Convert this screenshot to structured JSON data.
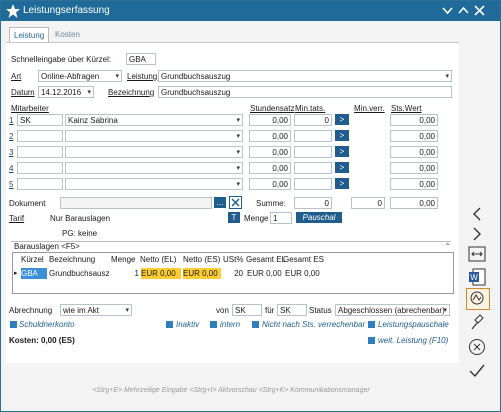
{
  "window": {
    "title": "Leistungserfassung"
  },
  "tabs": [
    {
      "label": "Leistung"
    },
    {
      "label": "Kosten"
    }
  ],
  "quick": {
    "label": "Schnelleingabe über Kürzel:",
    "value": "GBA"
  },
  "art": {
    "label": "Art",
    "value": "Online-Abfragen"
  },
  "leistung": {
    "label": "Leistung",
    "value": "Grundbuchsauszug"
  },
  "datum": {
    "label": "Datum",
    "value": "14.12.2016"
  },
  "bezeichnung": {
    "label": "Bezeichnung",
    "value": "Grundbuchsauszug"
  },
  "headers": {
    "mitarbeiter": "Mitarbeiter",
    "stundensatz": "Stundensatz",
    "min_tats": "Min.tats.",
    "min_verr": "Min.verr.",
    "sts_wert": "Sts.Wert"
  },
  "rows": [
    {
      "num": "1",
      "kuerzel": "SK",
      "name": "Kainz Sabrina",
      "stundensatz": "0,00",
      "min_tats": "0",
      "btn": ">",
      "sts_wert": "0,00"
    },
    {
      "num": "2",
      "kuerzel": "",
      "name": "",
      "stundensatz": "0,00",
      "min_tats": "",
      "btn": ">",
      "sts_wert": "0,00"
    },
    {
      "num": "3",
      "kuerzel": "",
      "name": "",
      "stundensatz": "0,00",
      "min_tats": "",
      "btn": ">",
      "sts_wert": "0,00"
    },
    {
      "num": "4",
      "kuerzel": "",
      "name": "",
      "stundensatz": "0,00",
      "min_tats": "",
      "btn": ">",
      "sts_wert": "0,00"
    },
    {
      "num": "5",
      "kuerzel": "",
      "name": "",
      "stundensatz": "0,00",
      "min_tats": "",
      "btn": ">",
      "sts_wert": "0,00"
    }
  ],
  "dokument": {
    "label": "Dokument",
    "btn": "...",
    "summe_label": "Summe:",
    "summe_tats": "0",
    "summe_verr": "0",
    "summe_wert": "0,00"
  },
  "tarif": {
    "label": "Tarif",
    "value": "Nur Barauslagen",
    "t_btn": "T",
    "menge_label": "Menge",
    "menge_value": "1",
    "pauschal": "Pauschal"
  },
  "pg": "PG: keine",
  "barauslagen": {
    "title": "Barauslagen <F5>",
    "columns": [
      "Kürzel",
      "Bezeichnung",
      "Menge",
      "Netto (EL)",
      "Netto (ES)",
      "USt%",
      "Gesamt EL",
      "Gesamt ES"
    ],
    "row": [
      "GBA",
      "Grundbuchsausz",
      "1",
      "EUR 0,00",
      "EUR 0,00",
      "20",
      "EUR 0,00",
      "EUR 0,00"
    ]
  },
  "abrechnung": {
    "label": "Abrechnung",
    "value": "wie im Akt",
    "von_label": "von",
    "von_value": "SK",
    "fuer_label": "für",
    "fuer_value": "SK",
    "status_label": "Status",
    "status_value": "Abgeschlossen (abrechenbar)"
  },
  "flags": {
    "schuldnerkonto": "Schuldnerkonto",
    "inaktiv": "Inaktiv",
    "intern": "intern",
    "nicht_verrechenbar": "Nicht nach Sts. verrechenbar",
    "pauschale": "Leistungspauschale"
  },
  "kosten": "Kosten: 0,00 (ES)",
  "weitere": "weit. Leistung (F10)",
  "hint": "<Strg+E> Mehrzeilige Eingabe <Strg+I> Aktvorschau <Strg+K> Kommunikationsmanager",
  "colors": {
    "title_bar": "#1f6a99",
    "accent_blue": "#1f5d8c",
    "yellow": "#ffcc33",
    "highlight": "#3b8fd9"
  }
}
